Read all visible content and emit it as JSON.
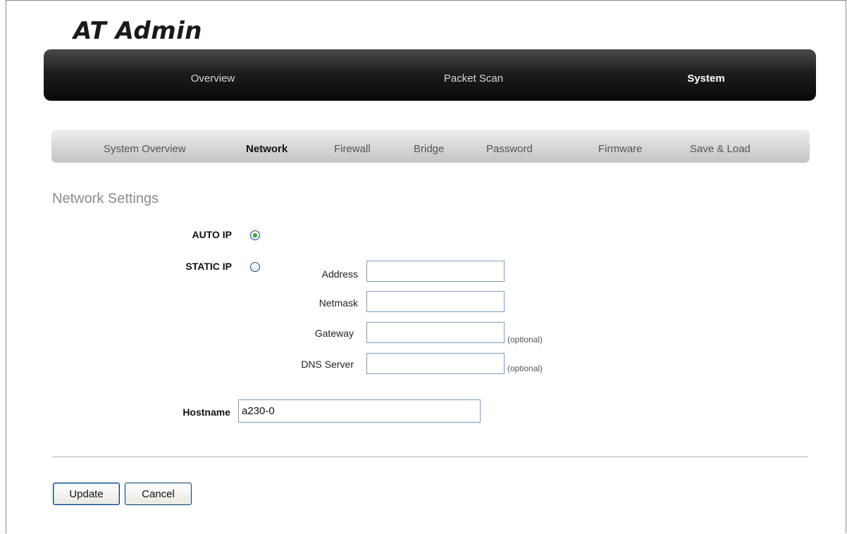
{
  "app": {
    "logo": "AT Admin"
  },
  "top_nav": {
    "tabs": [
      {
        "label": "Overview",
        "active": false
      },
      {
        "label": "Packet Scan",
        "active": false
      },
      {
        "label": "System",
        "active": true
      }
    ]
  },
  "sub_nav": {
    "tabs": [
      {
        "label": "System Overview",
        "active": false
      },
      {
        "label": "Network",
        "active": true
      },
      {
        "label": "Firewall",
        "active": false
      },
      {
        "label": "Bridge",
        "active": false
      },
      {
        "label": "Password",
        "active": false
      },
      {
        "label": "Firmware",
        "active": false
      },
      {
        "label": "Save & Load",
        "active": false
      }
    ]
  },
  "network_settings": {
    "title": "Network Settings",
    "auto_ip": {
      "label": "AUTO IP",
      "selected": true
    },
    "static_ip": {
      "label": "STATIC IP",
      "selected": false
    },
    "fields": {
      "address": {
        "label": "Address",
        "value": ""
      },
      "netmask": {
        "label": "Netmask",
        "value": ""
      },
      "gateway": {
        "label": "Gateway",
        "value": "",
        "note": "(optional)"
      },
      "dns": {
        "label": "DNS Server",
        "value": "",
        "note": "(optional)"
      }
    },
    "hostname": {
      "label": "Hostname",
      "value": "a230-0"
    }
  },
  "actions": {
    "update": "Update",
    "cancel": "Cancel"
  }
}
